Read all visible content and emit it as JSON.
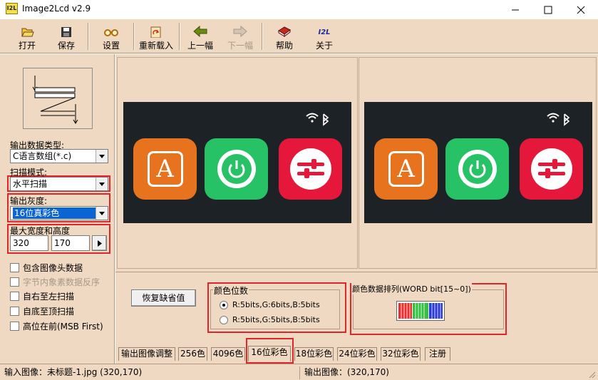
{
  "window": {
    "app_icon_text": "I2L",
    "title": "Image2Lcd v2.9"
  },
  "toolbar": [
    {
      "label": "打开",
      "icon": "open-folder-icon",
      "disabled": false
    },
    {
      "label": "保存",
      "icon": "save-disk-icon",
      "disabled": false
    },
    {
      "label": "设置",
      "icon": "glasses-settings-icon",
      "disabled": false
    },
    {
      "label": "重新载入",
      "icon": "reload-icon",
      "disabled": false
    },
    {
      "label": "上一幅",
      "icon": "arrow-left-icon",
      "disabled": false
    },
    {
      "label": "下一幅",
      "icon": "arrow-right-icon",
      "disabled": true
    },
    {
      "label": "帮助",
      "icon": "help-book-icon",
      "disabled": false
    },
    {
      "label": "关于",
      "icon": "i2l-about-icon",
      "disabled": false
    }
  ],
  "left": {
    "output_type_label": "输出数据类型:",
    "output_type_value": "C语言数组(*.c)",
    "scan_mode_label": "扫描模式:",
    "scan_mode_value": "水平扫描",
    "grayscale_label": "输出灰度:",
    "grayscale_value": "16位真彩色",
    "max_size_label": "最大宽度和高度",
    "max_width": "320",
    "max_height": "170",
    "checkboxes": [
      {
        "label": "包含图像头数据",
        "checked": false,
        "disabled": false
      },
      {
        "label": "字节内象素数据反序",
        "checked": false,
        "disabled": true
      },
      {
        "label": "自右至左扫描",
        "checked": false,
        "disabled": false
      },
      {
        "label": "自底至顶扫描",
        "checked": false,
        "disabled": false
      },
      {
        "label": "高位在前(MSB First)",
        "checked": false,
        "disabled": false
      }
    ]
  },
  "preview": {
    "icon_a_letter": "A"
  },
  "settings": {
    "restore_button": "恢复缺省值",
    "color_bits_label": "颜色位数",
    "radio_options": [
      {
        "label": "R:5bits,G:6bits,B:5bits",
        "selected": true
      },
      {
        "label": "R:5bits,G:5bits,B:5bits",
        "selected": false
      }
    ],
    "color_order_label": "颜色数据排列(WORD bit[15~0])"
  },
  "tabs": [
    {
      "label": "输出图像调整",
      "active": false
    },
    {
      "label": "256色",
      "active": false
    },
    {
      "label": "4096色",
      "active": false
    },
    {
      "label": "16位彩色",
      "active": true
    },
    {
      "label": "18位彩色",
      "active": false
    },
    {
      "label": "24位彩色",
      "active": false
    },
    {
      "label": "32位彩色",
      "active": false
    },
    {
      "label": "注册",
      "active": false
    }
  ],
  "status": {
    "input_image": "输入图像：未标题-1.jpg (320,170)",
    "output_image": "输出图像：(320,170)"
  },
  "colors": {
    "panel_bg": "#efd9c2",
    "highlight_red": "#e0262a",
    "icon_orange": "#e8731f",
    "icon_green": "#28c266",
    "icon_red": "#e5173b",
    "selection_blue": "#0a64d2"
  }
}
